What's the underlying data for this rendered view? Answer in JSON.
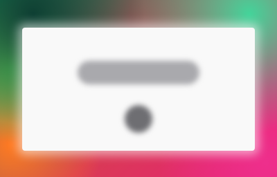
{
  "colors": {
    "dialog_background": "#f9f9f9",
    "message_placeholder": "#a9a9ad",
    "action_placeholder": "#6e6e72"
  },
  "icons": {
    "action": "circle-icon"
  }
}
